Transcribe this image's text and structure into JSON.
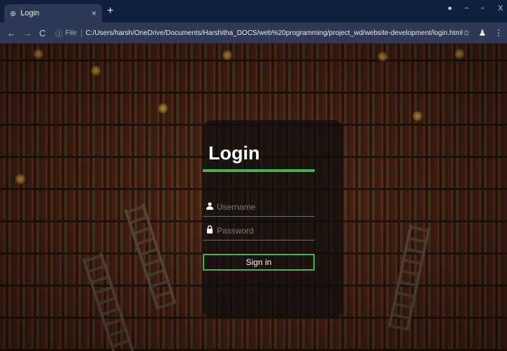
{
  "browser": {
    "tab_title": "Login",
    "tab_close": "×",
    "new_tab": "+",
    "file_label": "File",
    "url": "C:/Users/harsh/OneDrive/Documents/Harshitha_DOCS/web%20programming/project_wd/website-development/login.html",
    "nav": {
      "back": "←",
      "forward": "→",
      "reload": "C"
    },
    "window": {
      "minimize": "−",
      "maximize": "▫",
      "close": "X"
    }
  },
  "login": {
    "title": "Login",
    "username_placeholder": "Username",
    "password_placeholder": "Password",
    "signin_label": "Sign in"
  },
  "colors": {
    "accent": "#4caf50",
    "chrome_dark": "#0f1f3d",
    "chrome_toolbar": "#2e3a55",
    "card_bg": "rgba(12,12,12,0.72)"
  },
  "icons": {
    "tab": "globe-icon",
    "username": "user-icon",
    "password": "lock-icon",
    "bookmark": "star-icon",
    "profile": "profile-icon",
    "menu": "kebab-menu-icon",
    "extension": "extension-icon"
  }
}
